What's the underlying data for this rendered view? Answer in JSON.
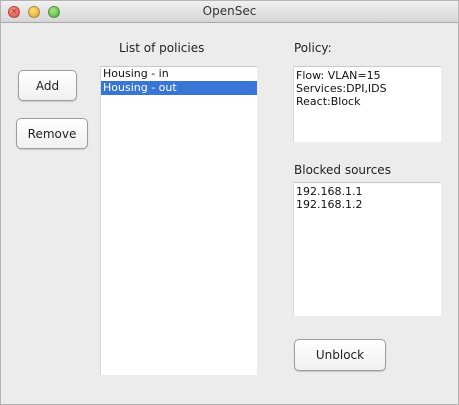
{
  "window": {
    "title": "OpenSec",
    "controls": {
      "close_glyph": "×",
      "minimize_glyph": "",
      "maximize_glyph": ""
    }
  },
  "sidebar": {
    "add_label": "Add",
    "remove_label": "Remove"
  },
  "policies": {
    "header": "List of policies",
    "items": [
      {
        "label": "Housing - in",
        "selected": false
      },
      {
        "label": "Housing - out",
        "selected": true
      }
    ]
  },
  "policy_detail": {
    "header": "Policy:",
    "lines": [
      "Flow: VLAN=15",
      "Services:DPI,IDS",
      "React:Block"
    ]
  },
  "blocked": {
    "header": "Blocked sources",
    "items": [
      "192.168.1.1",
      "192.168.1.2"
    ],
    "unblock_label": "Unblock"
  },
  "colors": {
    "selection": "#3875d7",
    "window_bg": "#ececec"
  }
}
